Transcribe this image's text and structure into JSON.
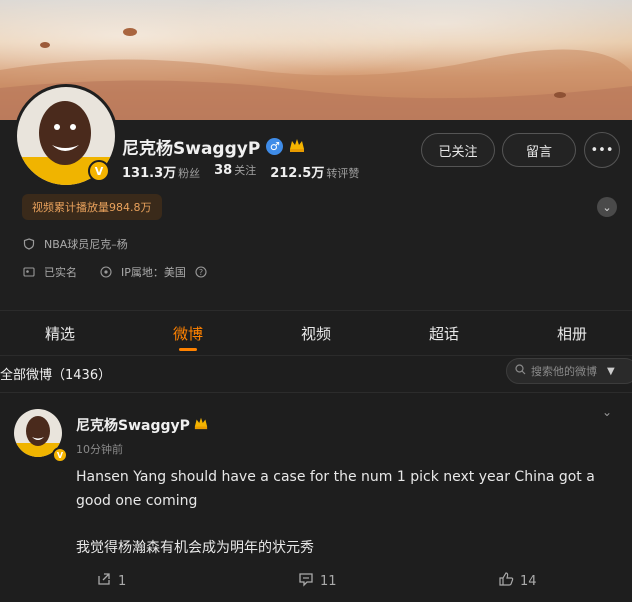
{
  "profile": {
    "name": "尼克杨SwaggyP",
    "gender_icon": "♂",
    "verified_badge": "V",
    "crown_icon": "crown-icon",
    "stats": [
      {
        "value": "131.3万",
        "label": "粉丝"
      },
      {
        "value": "38",
        "label": "关注"
      },
      {
        "value": "212.5万",
        "label": "转评赞"
      }
    ],
    "follow_label": "已关注",
    "message_label": "留言",
    "more_label": "•••",
    "views_label": "视频累计播放量984.8万",
    "bio": "NBA球员尼克–杨",
    "real_name": "已实名",
    "ip_label": "IP属地：美国"
  },
  "tabs": [
    "精选",
    "微博",
    "视频",
    "超话",
    "相册"
  ],
  "active_tab": 1,
  "filter": {
    "all_posts_label": "全部微博（1436）",
    "search_placeholder": "搜索他的微博"
  },
  "post": {
    "author": "尼克杨SwaggyP",
    "time": "10分钟前",
    "text_en_1": "Hansen Yang should have a case for the num 1 pick next year China got a",
    "text_en_2": "good one coming",
    "text_cn": "我觉得杨瀚森有机会成为明年的状元秀",
    "reposts": "1",
    "comments": "11",
    "likes": "14"
  },
  "colors": {
    "accent": "#ff8200",
    "verified": "#f5b400",
    "gender": "#3f8ce8"
  }
}
